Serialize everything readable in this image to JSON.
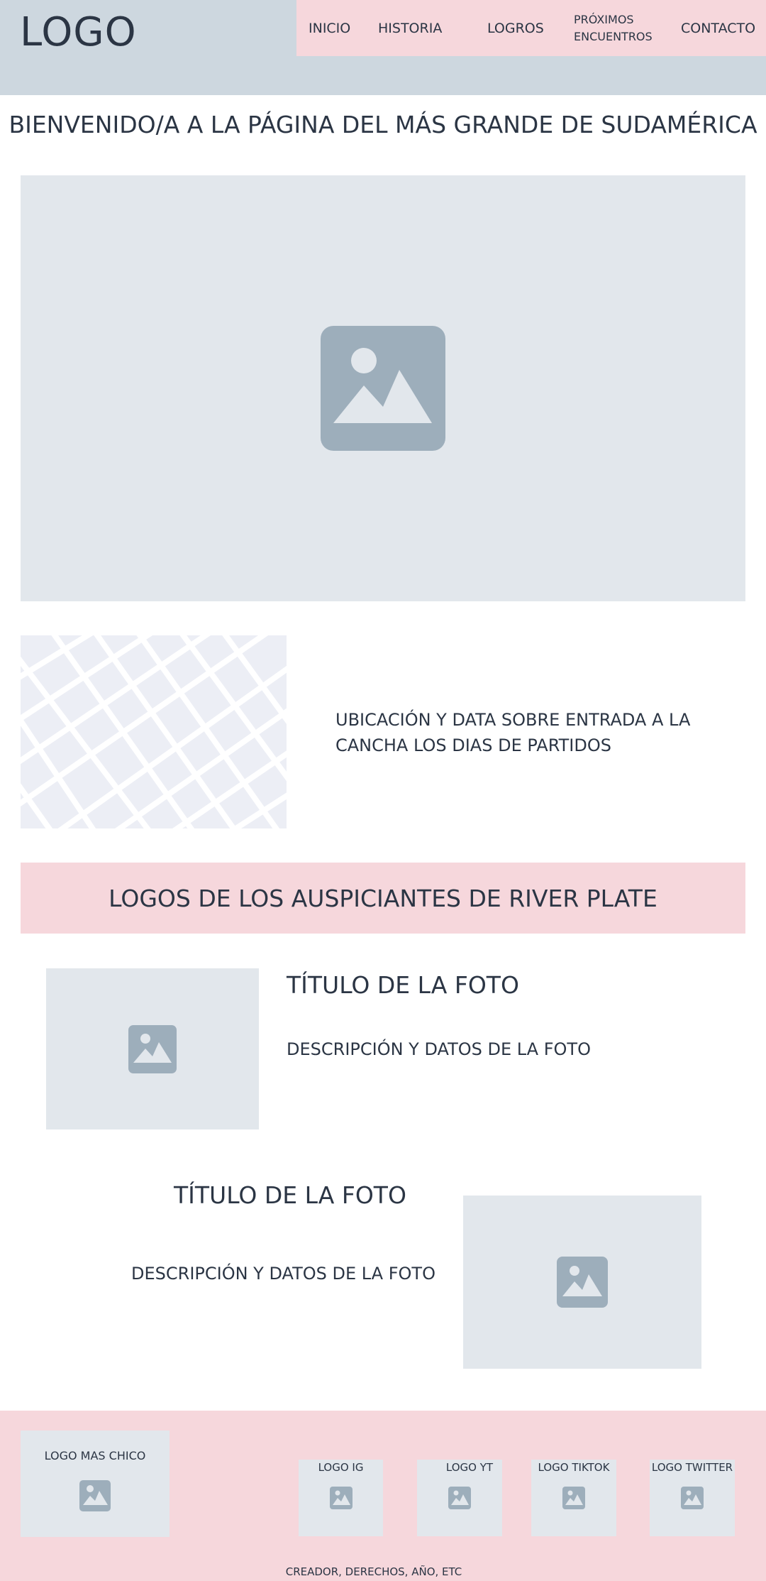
{
  "header": {
    "logo": "LOGO",
    "nav": [
      "INICIO",
      "HISTORIA",
      "LOGROS",
      "PRÓXIMOS",
      "ENCUENTROS",
      "CONTACTO"
    ]
  },
  "welcome": "BIENVENIDO/A A LA PÁGINA DEL MÁS GRANDE DE SUDAMÉRICA",
  "location": {
    "text": "UBICACIÓN Y DATA SOBRE ENTRADA A LA CANCHA LOS DIAS DE PARTIDOS"
  },
  "sponsors": {
    "title": "LOGOS DE LOS AUSPICIANTES DE RIVER PLATE"
  },
  "photos": [
    {
      "title": "TÍTULO DE LA FOTO",
      "description": "DESCRIPCIÓN Y DATOS DE LA FOTO"
    },
    {
      "title": "TÍTULO DE LA FOTO",
      "description": "DESCRIPCIÓN Y DATOS DE LA FOTO"
    }
  ],
  "footer": {
    "small_logo": "LOGO MAS CHICO",
    "social": [
      "LOGO IG",
      "LOGO YT",
      "LOGO TIKTOK",
      "LOGO TWITTER"
    ],
    "credits": "CREADOR, DERECHOS, AÑO, ETC"
  },
  "colors": {
    "header_bg": "#cdd7df",
    "accent_pink": "#f6d7dc",
    "placeholder": "#e2e7ec",
    "icon": "#9daebb",
    "text": "#2b3544"
  }
}
